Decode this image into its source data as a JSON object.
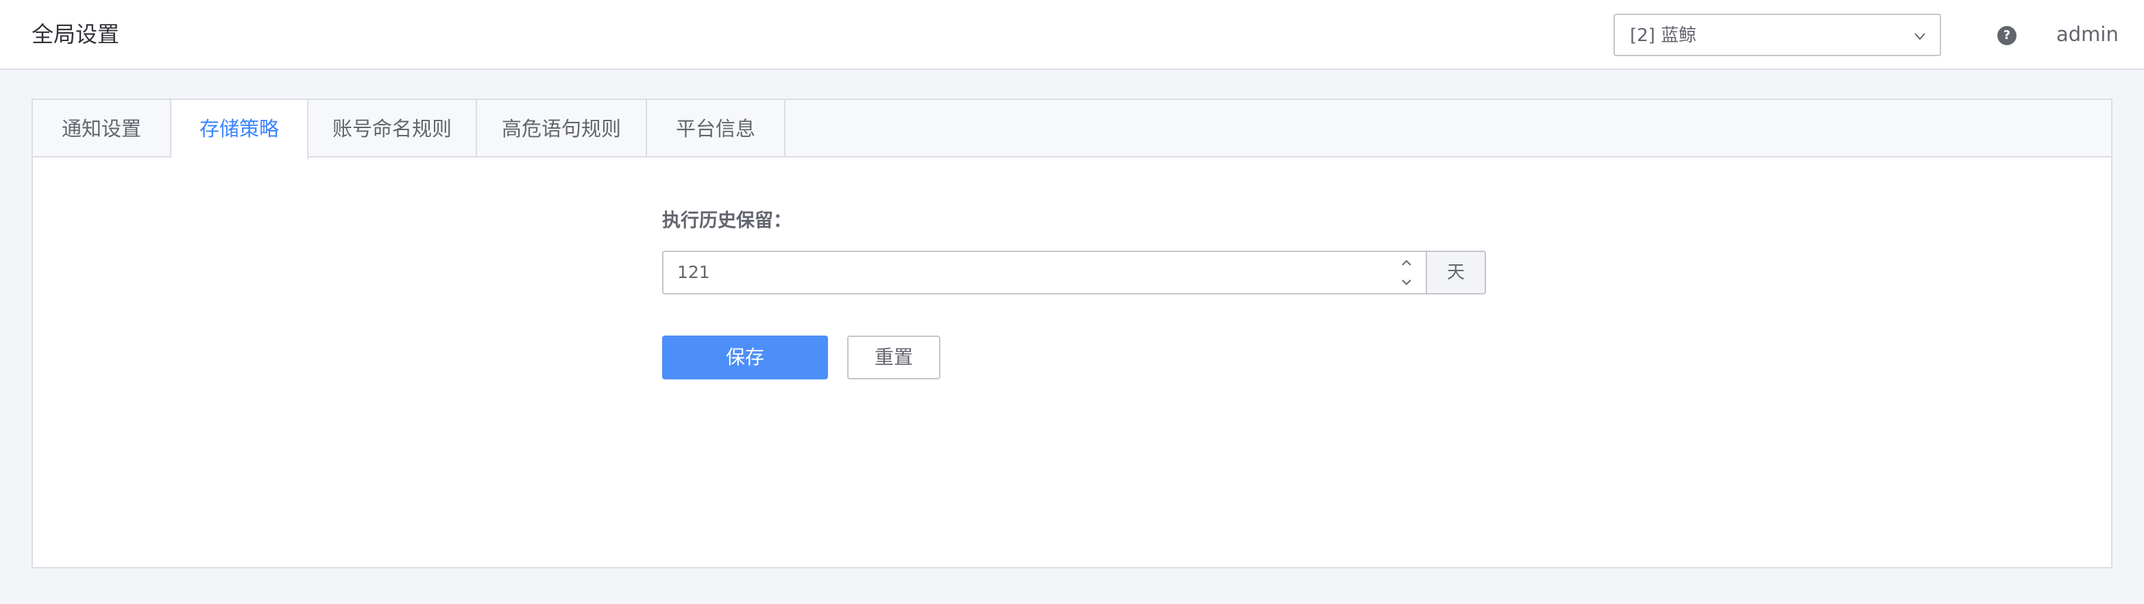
{
  "header": {
    "title": "全局设置",
    "business_select": {
      "value": "[2] 蓝鲸",
      "icon": "chevron-down-icon"
    },
    "help_icon": "?",
    "user": "admin"
  },
  "tabs": [
    {
      "label": "通知设置",
      "active": false
    },
    {
      "label": "存储策略",
      "active": true
    },
    {
      "label": "账号命名规则",
      "active": false
    },
    {
      "label": "高危语句规则",
      "active": false
    },
    {
      "label": "平台信息",
      "active": false
    }
  ],
  "form": {
    "label": "执行历史保留：",
    "value": "121",
    "unit": "天",
    "save_label": "保存",
    "reset_label": "重置"
  },
  "colors": {
    "accent": "#3a84ff",
    "primary_button": "#4d8ff9",
    "background": "#f4f5f9",
    "border": "#dcdee5"
  }
}
